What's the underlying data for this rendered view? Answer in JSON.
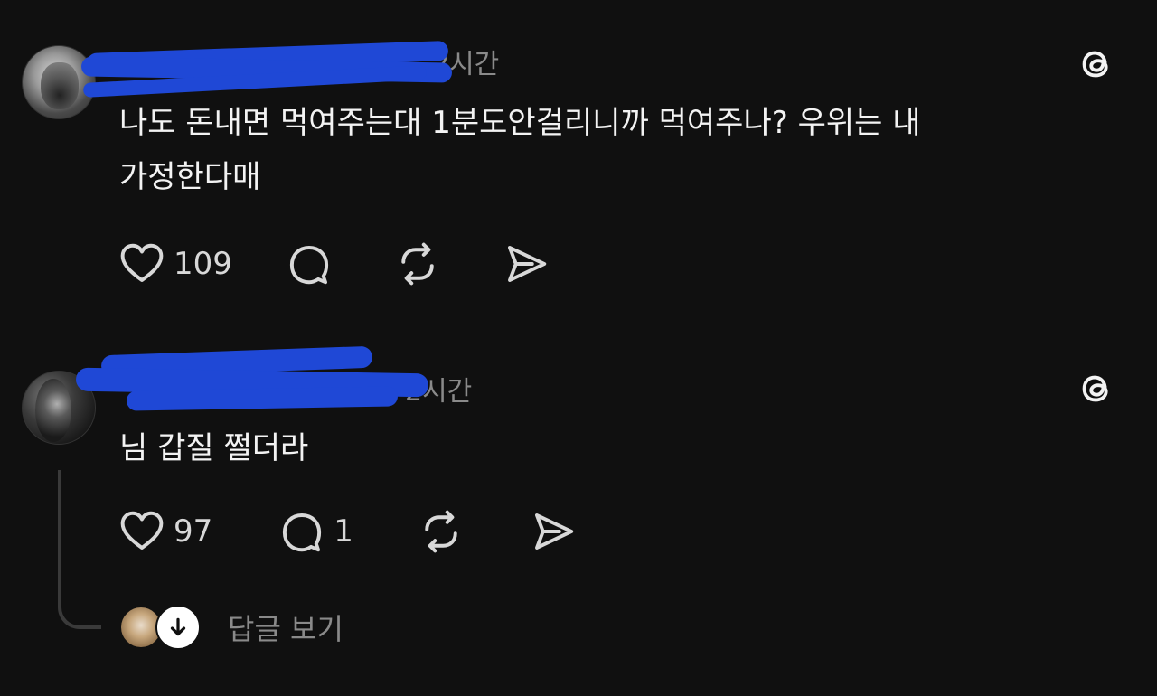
{
  "posts": [
    {
      "username": "",
      "time": "2시간",
      "text_line1": "나도 돈내면 먹여주는대 1분도안걸리니까 먹여주나? 우위는 내",
      "text_line2": "가정한다매",
      "likes": "109",
      "comments": "",
      "icons": [
        "heart-icon",
        "comment-icon",
        "repost-icon",
        "share-icon",
        "threads-logo-icon"
      ]
    },
    {
      "username": "",
      "time": "2시간",
      "text_line1": "님 갑질 쩔더라",
      "likes": "97",
      "comments": "1",
      "icons": [
        "heart-icon",
        "comment-icon",
        "repost-icon",
        "share-icon",
        "threads-logo-icon"
      ]
    }
  ],
  "replies": {
    "label": "답글 보기",
    "icon": "arrow-down-icon"
  },
  "colors": {
    "background": "#101010",
    "text": "#f3f3f3",
    "muted": "#8a8a8a",
    "redaction": "#1f48d6"
  }
}
